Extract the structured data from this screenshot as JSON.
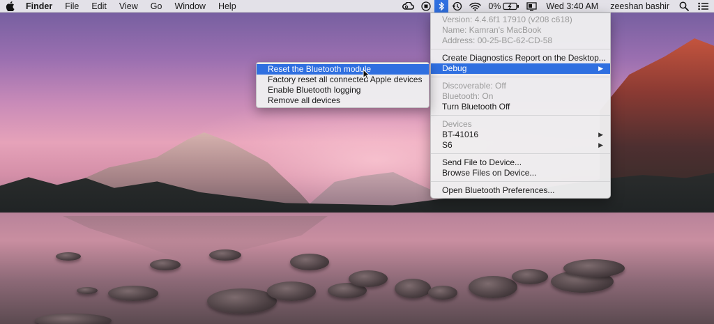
{
  "menubar": {
    "apple_icon": "apple-logo-icon",
    "app_name": "Finder",
    "menus": [
      "File",
      "Edit",
      "View",
      "Go",
      "Window",
      "Help"
    ],
    "status": {
      "battery_percent": "0%",
      "clock": "Wed 3:40 AM",
      "user": "zeeshan bashir"
    }
  },
  "bluetooth_menu": {
    "info": {
      "version": "Version: 4.4.6f1 17910 (v208 c618)",
      "name": "Name: Kamran's MacBook",
      "address": "Address: 00-25-BC-62-CD-58"
    },
    "create_diagnostics": "Create Diagnostics Report on the Desktop...",
    "debug": "Debug",
    "discoverable": "Discoverable: Off",
    "bluetooth_state": "Bluetooth: On",
    "turn_off": "Turn Bluetooth Off",
    "devices_header": "Devices",
    "devices": [
      "BT-41016",
      "S6"
    ],
    "send_file": "Send File to Device...",
    "browse_files": "Browse Files on Device...",
    "open_prefs": "Open Bluetooth Preferences..."
  },
  "debug_submenu": {
    "items": [
      "Reset the Bluetooth module",
      "Factory reset all connected Apple devices",
      "Enable Bluetooth logging",
      "Remove all devices"
    ]
  },
  "colors": {
    "selection": "#2f6fe0",
    "menu_bg": "#eeeef0"
  }
}
